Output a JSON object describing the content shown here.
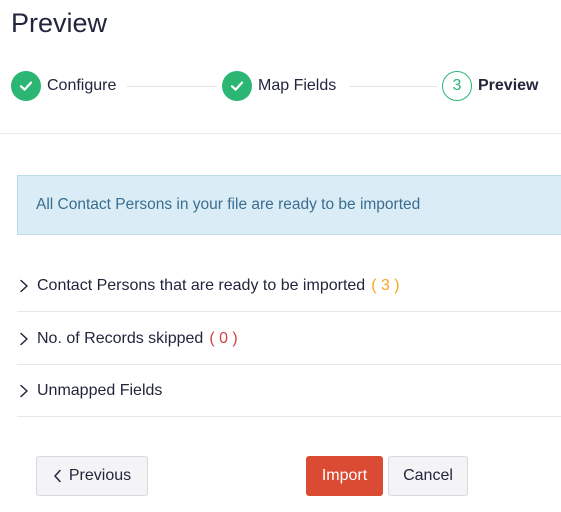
{
  "page": {
    "title": "Preview"
  },
  "stepper": {
    "steps": [
      {
        "label": "Configure",
        "state": "completed"
      },
      {
        "label": "Map Fields",
        "state": "completed"
      },
      {
        "number": "3",
        "label": "Preview",
        "state": "current"
      }
    ]
  },
  "alert": {
    "message": "All Contact Persons in your file are ready to be imported"
  },
  "sections": [
    {
      "label": "Contact Persons that are ready to be imported",
      "count": "( 3 )"
    },
    {
      "label": "No. of Records skipped",
      "count": "( 0 )"
    },
    {
      "label": "Unmapped Fields"
    }
  ],
  "actions": {
    "previous_label": "Previous",
    "import_label": "Import",
    "cancel_label": "Cancel"
  },
  "colors": {
    "success": "#2bb673",
    "accent_button": "#db4a32",
    "alert_bg": "#daedf6",
    "count_ready": "#f5a623",
    "count_skipped": "#d14343"
  }
}
